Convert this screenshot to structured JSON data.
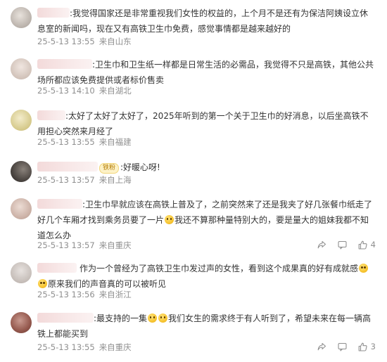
{
  "comments": [
    {
      "avatar_color": "#c9c3bd",
      "text": ":我觉得国家还是非常重视我们女性的权益的，上个月不是还有为保洁阿姨设立休息室的新闻吗，现在又有高铁卫生巾免费，感觉事情都是越来越好的",
      "time": "25-5-13 13:55",
      "location": "来自山东",
      "likes": ""
    },
    {
      "avatar_color": "#d8cdc6",
      "text": ":卫生巾和卫生纸一样都是日常生活的必需品，我觉得不只是高铁，其他公共场所都应该免费提供或者标价售卖",
      "time": "25-5-13 14:10",
      "location": "来自湖北",
      "likes": ""
    },
    {
      "avatar_color": "#d9d0a6",
      "text": ":太好了太好了太好了，2025年听到的第一个关于卫生巾的好消息，以后坐高铁不用担心突然来月经了",
      "time": "25-5-13 13:55",
      "location": "来自福建",
      "likes": ""
    },
    {
      "avatar_color": "#5b5550",
      "badge": "铁粉",
      "text": ":好暖心呀!",
      "time": "25-5-13 13:57",
      "location": "来自上海",
      "likes": ""
    },
    {
      "avatar_color": "#cdb7ae",
      "text_a": ":卫生巾早就应该在高铁上普及了，之前突然来了还是我夹了好几张餐巾纸走了好几个车厢才找到乘务员要了一片",
      "text_b": "我还不算那种量特别大的，要是量大的姐妹我都不知道怎么办",
      "time": "25-5-13 13:57",
      "location": "来自重庆",
      "likes": "4"
    },
    {
      "avatar_color": "#c8c2bf",
      "text_a": "作为一个曾经为了高铁卫生巾发过声的女性，看到这个成果真的好有成就感",
      "text_b": "原来我们的声音真的可以被听见",
      "time": "25-5-13 13:56",
      "location": "来自浙江",
      "likes": ""
    },
    {
      "avatar_color": "#9d6b62",
      "text_a": ":最支持的一集",
      "text_b": "我们女生的需求终于有人听到了，希望未来在每一辆高铁上都能买到",
      "time": "25-5-13 13:55",
      "location": "来自重庆",
      "likes": "3"
    }
  ]
}
